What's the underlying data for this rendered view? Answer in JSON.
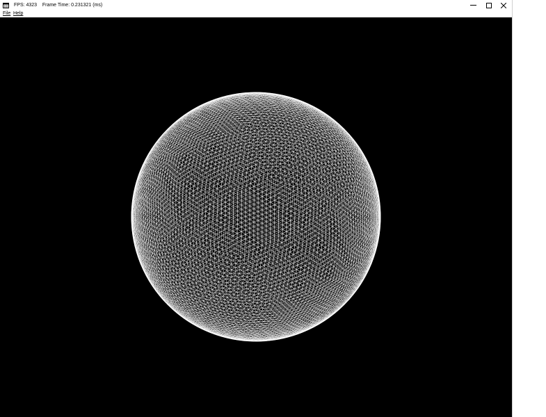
{
  "window": {
    "title": "FPS: 4323    Frame Time: 0.231321 (ms)",
    "icon": "app-window-icon",
    "controls": {
      "minimize_icon": "minimize-icon",
      "maximize_icon": "maximize-icon",
      "close_icon": "close-icon"
    }
  },
  "menu": {
    "file": "File",
    "help": "Help"
  },
  "viewport": {
    "background": "#000000",
    "mesh_color": "#ffffff",
    "content": "wireframe-sphere"
  }
}
